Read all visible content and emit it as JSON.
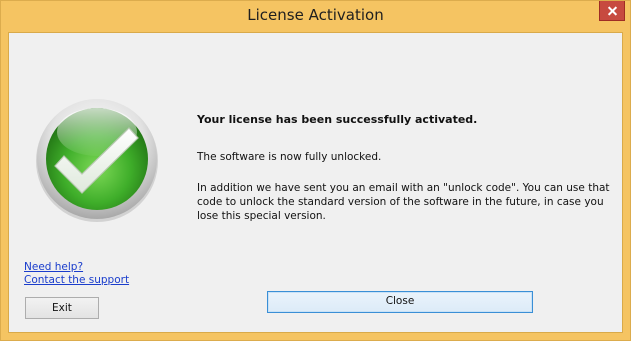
{
  "window": {
    "title": "License Activation",
    "accent_color": "#f5c462",
    "close_icon": "close-x-icon"
  },
  "main": {
    "icon": "green-checkmark-icon",
    "headline": "Your license has been successfully activated.",
    "line1": "The software is now fully unlocked.",
    "paragraph": "In addition we have sent you an email with an \"unlock code\". You can use that code to unlock the standard version of the software in the future, in case you lose this special version."
  },
  "links": {
    "help": "Need help?",
    "support": "Contact the support"
  },
  "buttons": {
    "exit": "Exit",
    "close": "Close"
  }
}
